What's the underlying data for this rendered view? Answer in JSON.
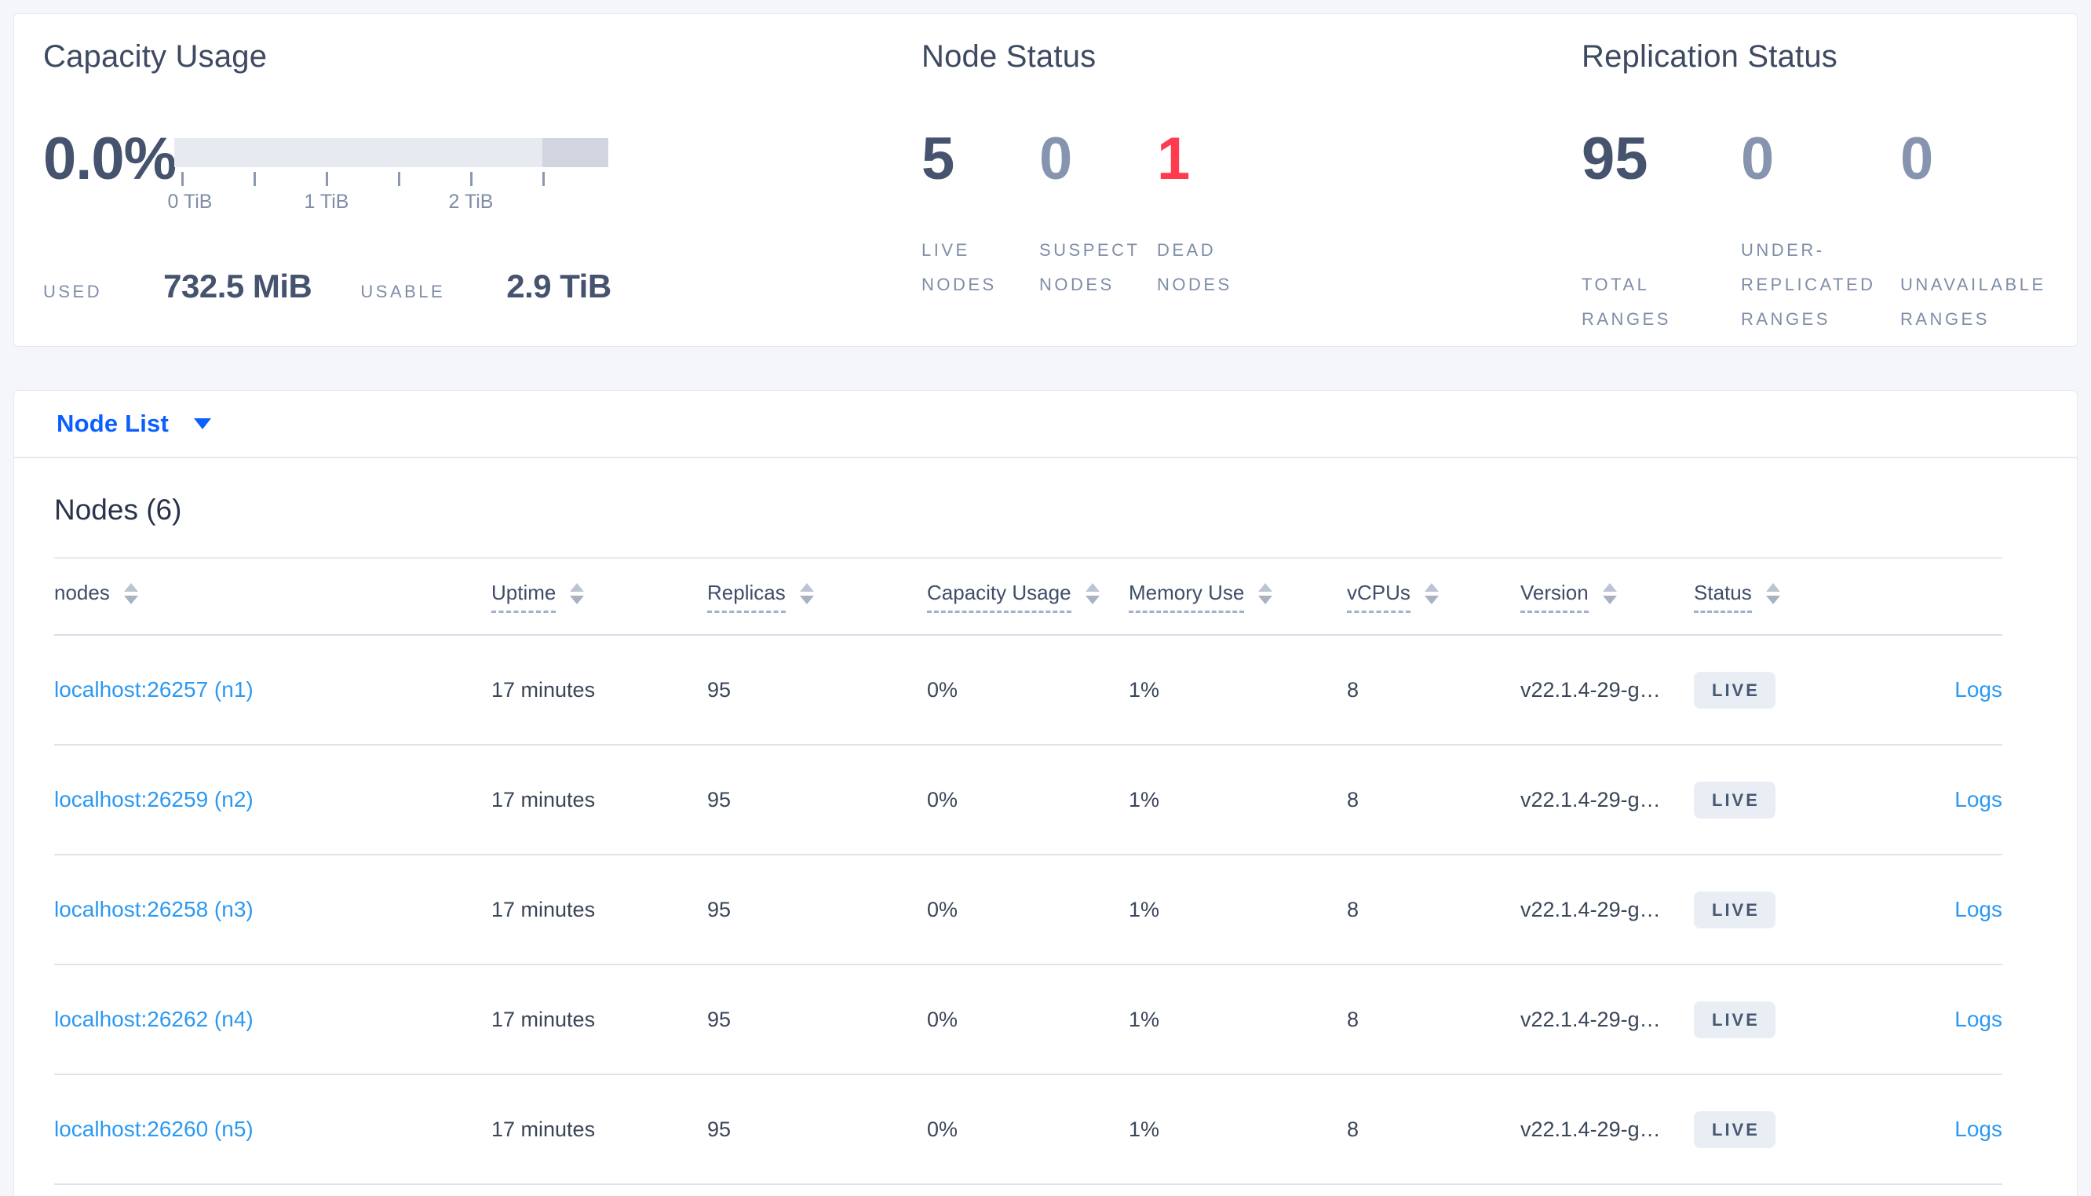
{
  "colors": {
    "page_bg": "#f4f6fa",
    "card_bg": "#ffffff",
    "card_border": "#e4e8ef",
    "title": "#3e4a61",
    "heading": "#29344a",
    "number_dark": "#46536e",
    "number_muted": "#8694af",
    "number_red": "#ff3b4d",
    "label_muted": "#7f8da7",
    "bar_light": "#e8eaf1",
    "bar_dark": "#d1d5e0",
    "tick": "#8b98b0",
    "link_primary": "#0b5fff",
    "link_row": "#2b99f2",
    "cell_text": "#3a4557",
    "header_text": "#3f4d68",
    "divider": "#dfe3ec",
    "header_divider": "#d9dde7",
    "underline": "#9fb0d0",
    "sort_arrow": "#bcc4d3",
    "sort_arrow_down": "#a9b2c3",
    "badge_bg": "#e9edf4",
    "badge_text": "#475872"
  },
  "summary": {
    "capacity": {
      "title": "Capacity Usage",
      "percent": "0.0%",
      "bar": {
        "light_fraction": 0.85,
        "dark_fraction": 0.15
      },
      "tick_labels": [
        "0 TiB",
        "1 TiB",
        "2 TiB"
      ],
      "used_label": "USED",
      "used_value": "732.5 MiB",
      "usable_label": "USABLE",
      "usable_value": "2.9 TiB"
    },
    "node_status": {
      "title": "Node Status",
      "stats": [
        {
          "value": "5",
          "label": "LIVE NODES",
          "tone": "dark"
        },
        {
          "value": "0",
          "label": "SUSPECT NODES",
          "tone": "muted"
        },
        {
          "value": "1",
          "label": "DEAD NODES",
          "tone": "red"
        }
      ]
    },
    "replication": {
      "title": "Replication Status",
      "stats": [
        {
          "value": "95",
          "label": "TOTAL RANGES",
          "tone": "dark"
        },
        {
          "value": "0",
          "label": "UNDER-REPLICATED RANGES",
          "tone": "muted"
        },
        {
          "value": "0",
          "label": "UNAVAILABLE RANGES",
          "tone": "muted"
        }
      ]
    }
  },
  "node_list_bar": {
    "label": "Node List"
  },
  "nodes_section": {
    "heading": "Nodes (6)",
    "columns": {
      "nodes": "nodes",
      "uptime": "Uptime",
      "replicas": "Replicas",
      "capacity": "Capacity Usage",
      "memory": "Memory Use",
      "vcpus": "vCPUs",
      "version": "Version",
      "status": "Status"
    },
    "rows": [
      {
        "node": "localhost:26257 (n1)",
        "uptime": "17 minutes",
        "replicas": "95",
        "capacity": "0%",
        "memory": "1%",
        "vcpus": "8",
        "version": "v22.1.4-29-g…",
        "status": "LIVE",
        "logs": "Logs"
      },
      {
        "node": "localhost:26259 (n2)",
        "uptime": "17 minutes",
        "replicas": "95",
        "capacity": "0%",
        "memory": "1%",
        "vcpus": "8",
        "version": "v22.1.4-29-g…",
        "status": "LIVE",
        "logs": "Logs"
      },
      {
        "node": "localhost:26258 (n3)",
        "uptime": "17 minutes",
        "replicas": "95",
        "capacity": "0%",
        "memory": "1%",
        "vcpus": "8",
        "version": "v22.1.4-29-g…",
        "status": "LIVE",
        "logs": "Logs"
      },
      {
        "node": "localhost:26262 (n4)",
        "uptime": "17 minutes",
        "replicas": "95",
        "capacity": "0%",
        "memory": "1%",
        "vcpus": "8",
        "version": "v22.1.4-29-g…",
        "status": "LIVE",
        "logs": "Logs"
      },
      {
        "node": "localhost:26260 (n5)",
        "uptime": "17 minutes",
        "replicas": "95",
        "capacity": "0%",
        "memory": "1%",
        "vcpus": "8",
        "version": "v22.1.4-29-g…",
        "status": "LIVE",
        "logs": "Logs"
      }
    ]
  }
}
